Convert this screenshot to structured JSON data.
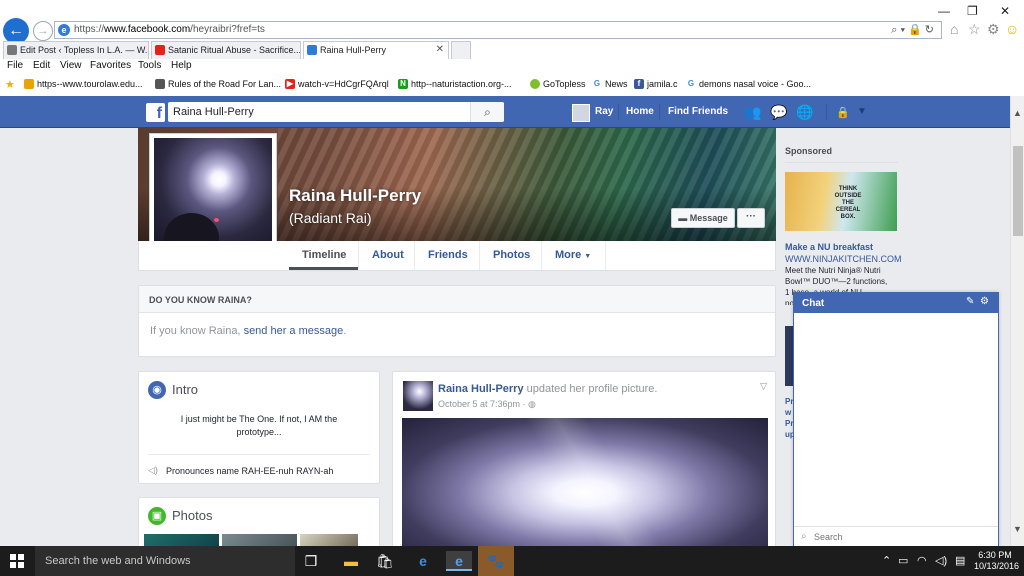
{
  "browser": {
    "url_prefix": "https://",
    "url_host": "www.facebook.com",
    "url_path": "/heyraibri?fref=ts",
    "tabs": [
      {
        "label": "Edit Post ‹ Topless In L.A. — W..."
      },
      {
        "label": "Satanic Ritual Abuse - Sacrifice..."
      },
      {
        "label": "Raina Hull-Perry"
      }
    ],
    "menu": [
      "File",
      "Edit",
      "View",
      "Favorites",
      "Tools",
      "Help"
    ],
    "favorites": [
      {
        "label": "https--www.tourolaw.edu...",
        "color": "#e8a400"
      },
      {
        "label": "Rules of the Road For Lan...",
        "color": "#555555"
      },
      {
        "label": "watch-v=HdCgrFQArql",
        "color": "#e62117"
      },
      {
        "label": "http--naturistaction.org-...",
        "color": "#14a014"
      },
      {
        "label": "GoTopless",
        "color": "#7fbf2e"
      },
      {
        "label": "News",
        "color": "#4285f4"
      },
      {
        "label": "jamila.c",
        "color": "#3b5998"
      },
      {
        "label": "demons nasal voice - Goo...",
        "color": "#4285f4"
      }
    ]
  },
  "fb": {
    "search_value": "Raina Hull-Perry",
    "user": "Ray",
    "home": "Home",
    "find_friends": "Find Friends",
    "brand_color": "#4267b2"
  },
  "profile": {
    "name": "Raina Hull-Perry",
    "alt_name": "(Radiant Rai)",
    "message_btn": "Message",
    "more_btn": "···",
    "tabs": [
      "Timeline",
      "About",
      "Friends",
      "Photos",
      "More"
    ]
  },
  "know": {
    "title": "DO YOU KNOW RAINA?",
    "prefix": "If you know Raina,",
    "link": "send her a message",
    "suffix": "."
  },
  "intro": {
    "title": "Intro",
    "bio": "I just might be The One. If not, I AM the prototype...",
    "pronounce": "Pronounces name RAH-EE-nuh RAYN-ah"
  },
  "photos": {
    "title": "Photos"
  },
  "post": {
    "author": "Raina Hull-Perry",
    "action": "updated her profile picture.",
    "time": "October 5 at 7:36pm · "
  },
  "sponsored": {
    "title": "Sponsored",
    "img_text": "THINK OUTSIDE THE CEREAL BOX.",
    "headline": "Make a NU breakfast",
    "url": "WWW.NINJAKITCHEN.COM",
    "desc": "Meet the Nutri Ninja® Nutri Bowl™ DUO™—2 functions, 1 base, a world of NU possibilities.",
    "second_text": "Pr w Pr up"
  },
  "chat": {
    "title": "Chat",
    "search_placeholder": "Search"
  },
  "taskbar": {
    "search_text": "Search the web and Windows",
    "time": "6:30 PM",
    "date": "10/13/2016"
  }
}
